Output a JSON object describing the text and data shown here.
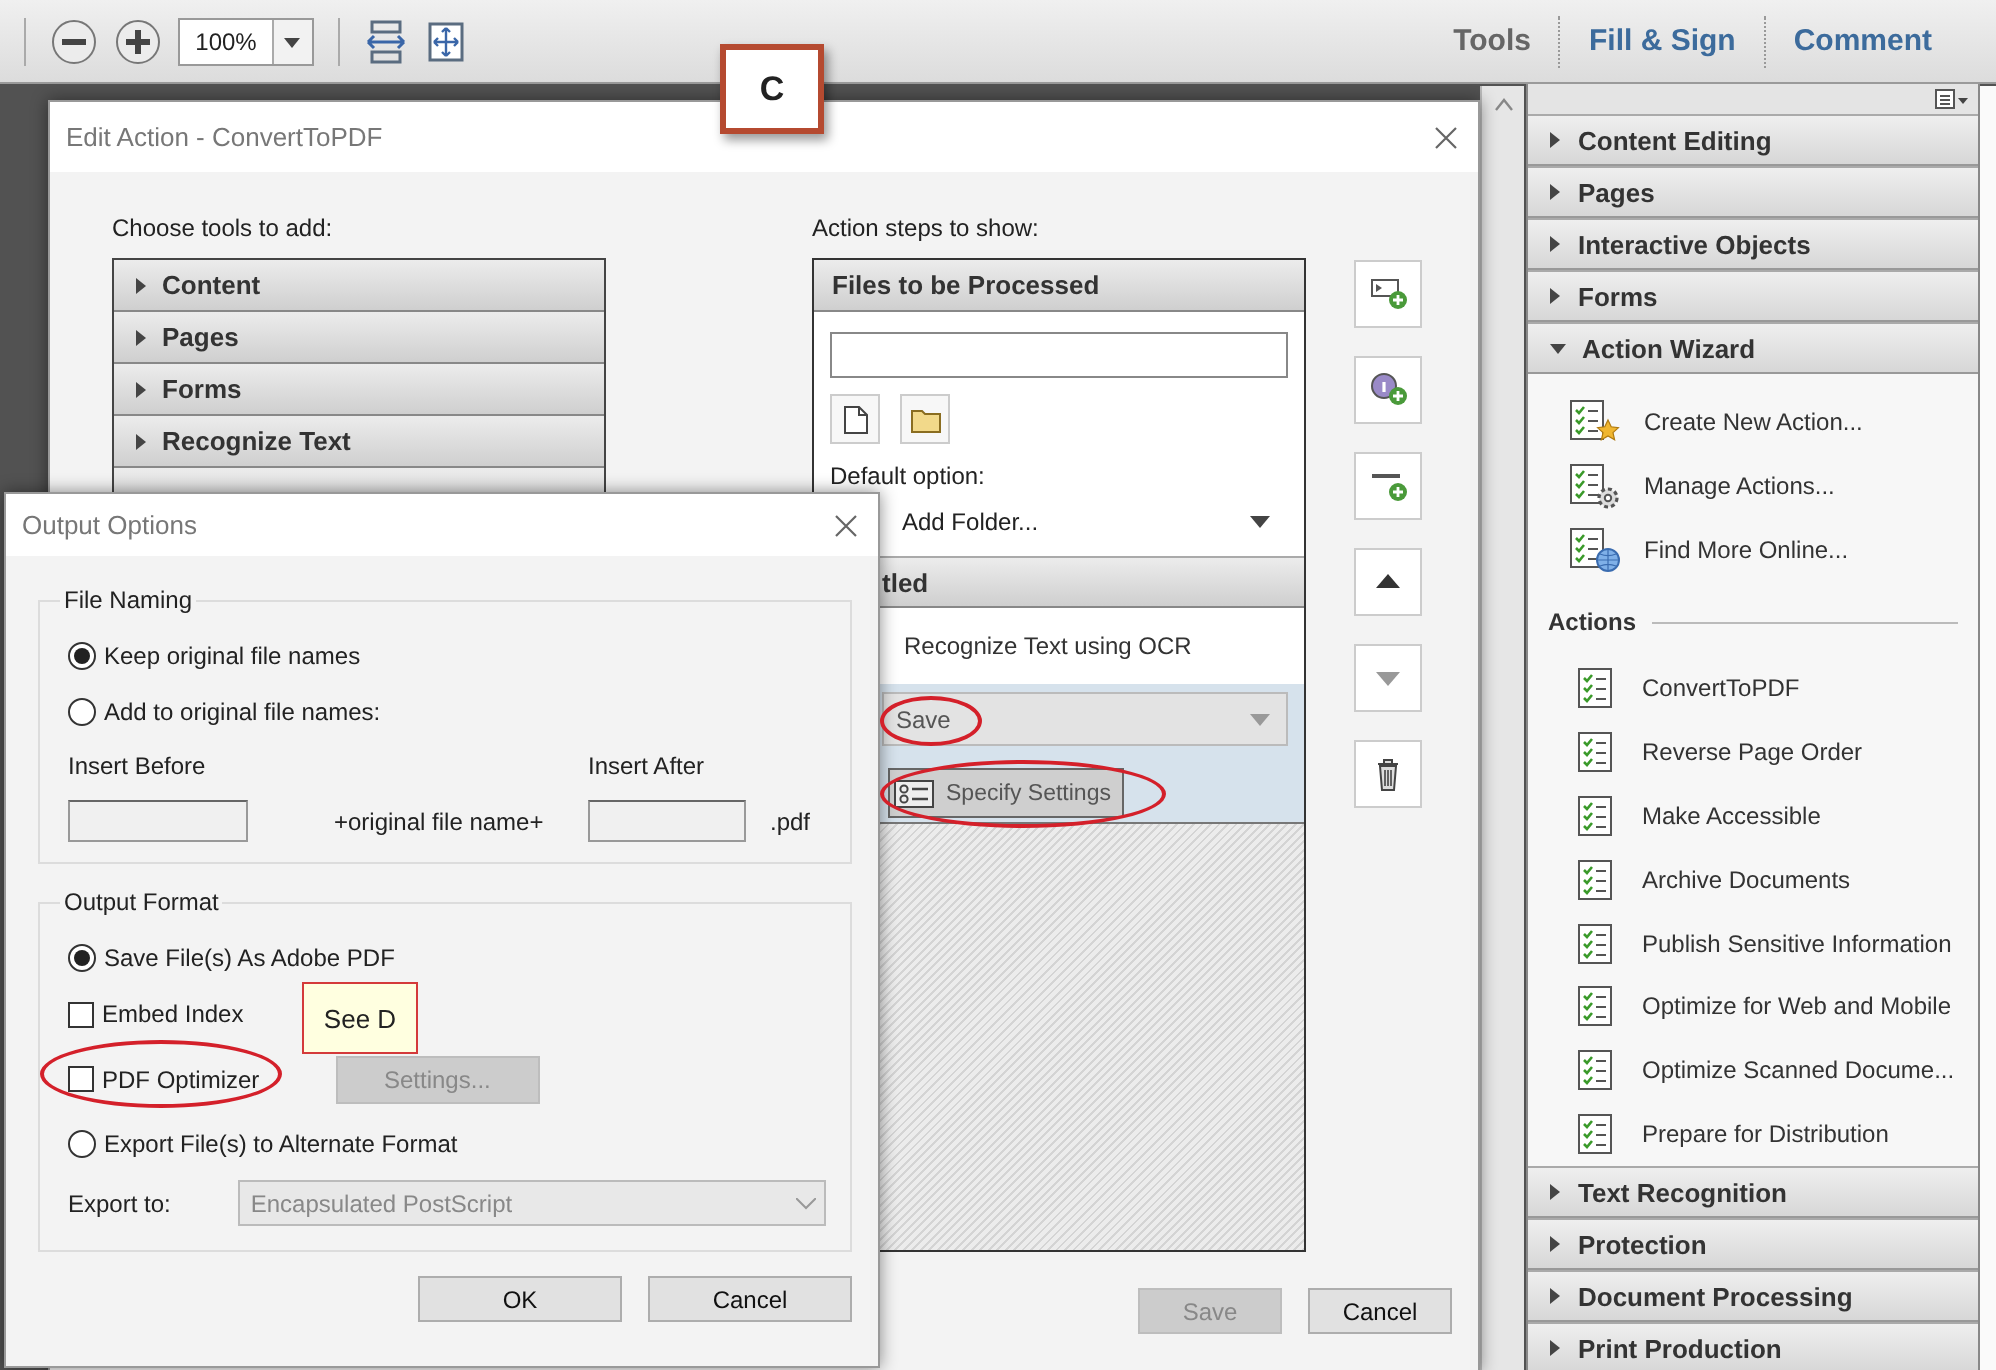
{
  "toolbar": {
    "zoom": "100%",
    "tabs": [
      {
        "label": "Tools",
        "selected": true
      },
      {
        "label": "Fill & Sign",
        "selected": false
      },
      {
        "label": "Comment",
        "selected": false
      }
    ]
  },
  "callout": {
    "label": "C"
  },
  "edit_action": {
    "title": "Edit Action - ConvertToPDF",
    "tools_label": "Choose tools to add:",
    "tool_groups": [
      {
        "label": "Content",
        "expanded": false
      },
      {
        "label": "Pages",
        "expanded": false
      },
      {
        "label": "Forms",
        "expanded": false
      },
      {
        "label": "Recognize Text",
        "expanded": false
      }
    ],
    "steps_label": "Action steps to show:",
    "files_header": "Files to be Processed",
    "default_option_label": "Default option:",
    "default_option": "Add Folder...",
    "group_header": "tled",
    "step": "Recognize Text using OCR",
    "selected_step": {
      "value": "Save",
      "button": "Specify Settings"
    },
    "buttons": [
      {
        "label": "Save",
        "disabled": true
      },
      {
        "label": "Cancel",
        "disabled": false
      }
    ]
  },
  "output_options": {
    "title": "Output Options",
    "file_naming": {
      "legend": "File Naming",
      "options": [
        {
          "label": "Keep original file names",
          "selected": true
        },
        {
          "label": "Add to original file names:",
          "selected": false
        }
      ],
      "insert_before_label": "Insert Before",
      "insert_after_label": "Insert After",
      "middle_text": "+original file name+",
      "suffix": ".pdf"
    },
    "output_format": {
      "legend": "Output Format",
      "save_pdf": {
        "label": "Save File(s) As Adobe PDF",
        "selected": true
      },
      "embed_index": {
        "label": "Embed Index",
        "checked": false
      },
      "pdf_optimizer": {
        "label": "PDF Optimizer",
        "checked": false
      },
      "settings_button": {
        "label": "Settings...",
        "disabled": true
      },
      "export_alt": {
        "label": "Export File(s) to Alternate Format",
        "selected": false
      },
      "export_to_label": "Export to:",
      "export_to": {
        "value": "Encapsulated PostScript",
        "disabled": true
      }
    },
    "buttons": [
      "OK",
      "Cancel"
    ]
  },
  "note": {
    "label": "See D"
  },
  "tools_panel": {
    "groups_before": [
      {
        "label": "Content Editing",
        "expanded": false
      },
      {
        "label": "Pages",
        "expanded": false
      },
      {
        "label": "Interactive Objects",
        "expanded": false
      },
      {
        "label": "Forms",
        "expanded": false
      }
    ],
    "wizard": {
      "label": "Action Wizard",
      "expanded": true,
      "commands": [
        {
          "kind": "create",
          "label": "Create New Action..."
        },
        {
          "kind": "manage",
          "label": "Manage Actions..."
        },
        {
          "kind": "find",
          "label": "Find More Online..."
        }
      ],
      "actions_label": "Actions",
      "actions": [
        "ConvertToPDF",
        "Reverse Page Order",
        "Make Accessible",
        "Archive Documents",
        "Publish Sensitive Information",
        "Optimize for Web and Mobile",
        "Optimize Scanned Docume...",
        "Prepare for Distribution"
      ]
    },
    "groups_after": [
      {
        "label": "Text Recognition",
        "expanded": false
      },
      {
        "label": "Protection",
        "expanded": false
      },
      {
        "label": "Document Processing",
        "expanded": false
      },
      {
        "label": "Print Production",
        "expanded": false
      }
    ]
  }
}
